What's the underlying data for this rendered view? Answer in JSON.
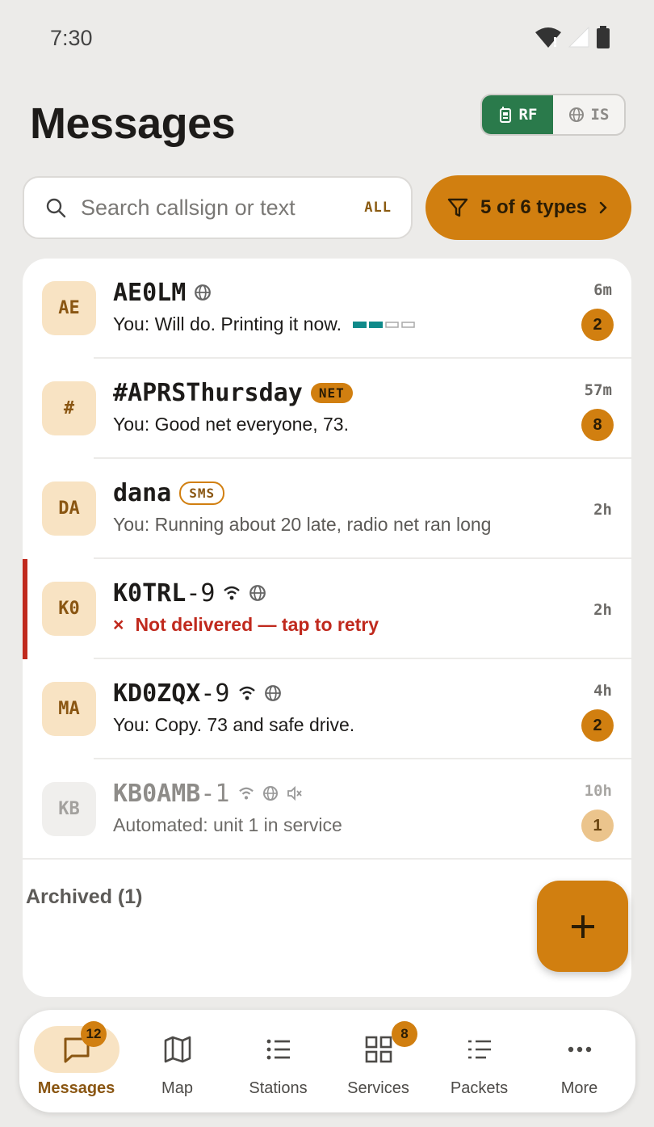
{
  "status": {
    "time": "7:30"
  },
  "header": {
    "title": "Messages",
    "rf_label": "RF",
    "is_label": "IS"
  },
  "search": {
    "placeholder": "Search callsign or text",
    "scope": "ALL"
  },
  "filter": {
    "label": "5 of 6 types"
  },
  "conversations": [
    {
      "avatar": "AE",
      "callsign": "AE0LM",
      "ssid": "",
      "preview": "You: Will do. Printing it now.",
      "time": "6m",
      "count": "2"
    },
    {
      "avatar": "#",
      "callsign": "#APRSThursday",
      "ssid": "",
      "badge": "NET",
      "preview": "You: Good net everyone, 73.",
      "time": "57m",
      "count": "8"
    },
    {
      "avatar": "DA",
      "callsign": "dana",
      "ssid": "",
      "badge": "SMS",
      "preview": "You: Running about 20 late, radio net ran long",
      "time": "2h"
    },
    {
      "avatar": "K0",
      "callsign": "K0TRL",
      "ssid": "-9",
      "preview": "Not delivered — tap to retry",
      "error_mark": "×",
      "time": "2h"
    },
    {
      "avatar": "MA",
      "callsign": "KD0ZQX",
      "ssid": "-9",
      "preview": "You: Copy. 73 and safe drive.",
      "time": "4h",
      "count": "2"
    },
    {
      "avatar": "KB",
      "callsign": "KB0AMB",
      "ssid": "-1",
      "preview": "Automated: unit 1 in service",
      "time": "10h",
      "count": "1"
    }
  ],
  "archived": {
    "label": "Archived (1)"
  },
  "fab": {
    "icon": "plus-icon",
    "glyph": "+"
  },
  "nav": {
    "items": [
      {
        "label": "Messages",
        "badge": "12",
        "icon": "message-icon"
      },
      {
        "label": "Map",
        "icon": "map-icon"
      },
      {
        "label": "Stations",
        "icon": "list-icon"
      },
      {
        "label": "Services",
        "badge": "8",
        "icon": "grid-icon"
      },
      {
        "label": "Packets",
        "icon": "packets-icon"
      },
      {
        "label": "More",
        "icon": "more-icon"
      }
    ]
  },
  "colors": {
    "accent": "#d17f10",
    "rf_green": "#2a7a4b",
    "error": "#c0291d",
    "avatar_bg": "#f8e3c3"
  }
}
